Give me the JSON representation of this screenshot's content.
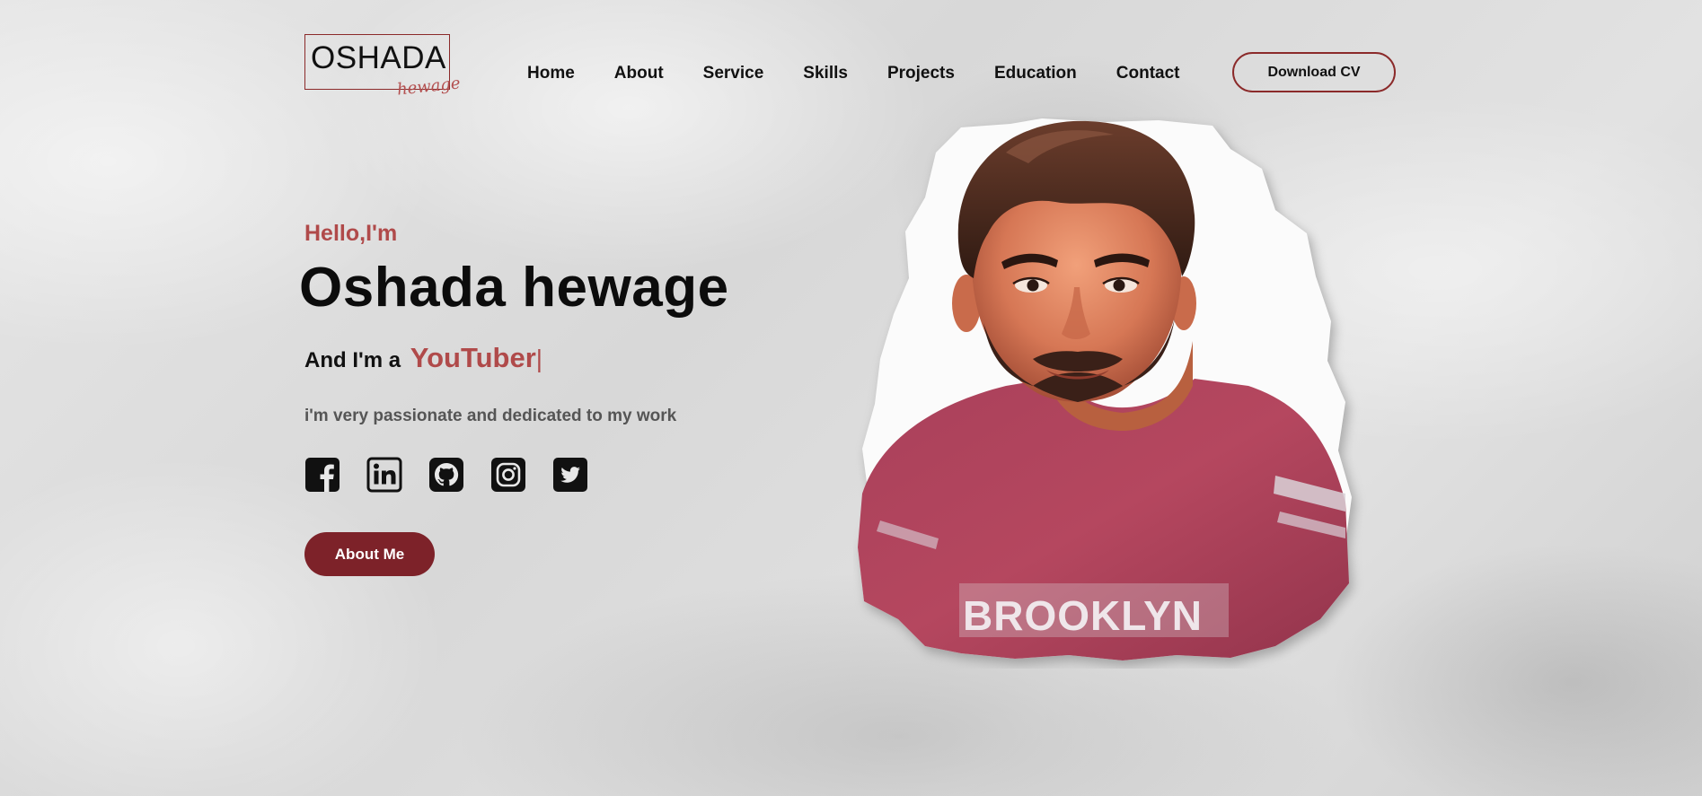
{
  "logo": {
    "text": "OSHADA",
    "script": "hewage"
  },
  "nav": {
    "items": [
      "Home",
      "About",
      "Service",
      "Skills",
      "Projects",
      "Education",
      "Contact"
    ]
  },
  "header": {
    "cv_button": "Download CV"
  },
  "hero": {
    "greeting": "Hello,I'm",
    "name": "Oshada hewage",
    "role_prefix": "And I'm a",
    "role": "YouTuber",
    "cursor": "|",
    "tagline": "i'm very passionate and dedicated to my work",
    "about_button": "About Me"
  },
  "socials": [
    "facebook-icon",
    "linkedin-icon",
    "github-icon",
    "instagram-icon",
    "twitter-icon"
  ],
  "portrait": {
    "shirt_text": "BROOKLYN"
  },
  "colors": {
    "accent": "#b04a4a",
    "button": "#7d2229",
    "border": "#8b2a2a"
  }
}
